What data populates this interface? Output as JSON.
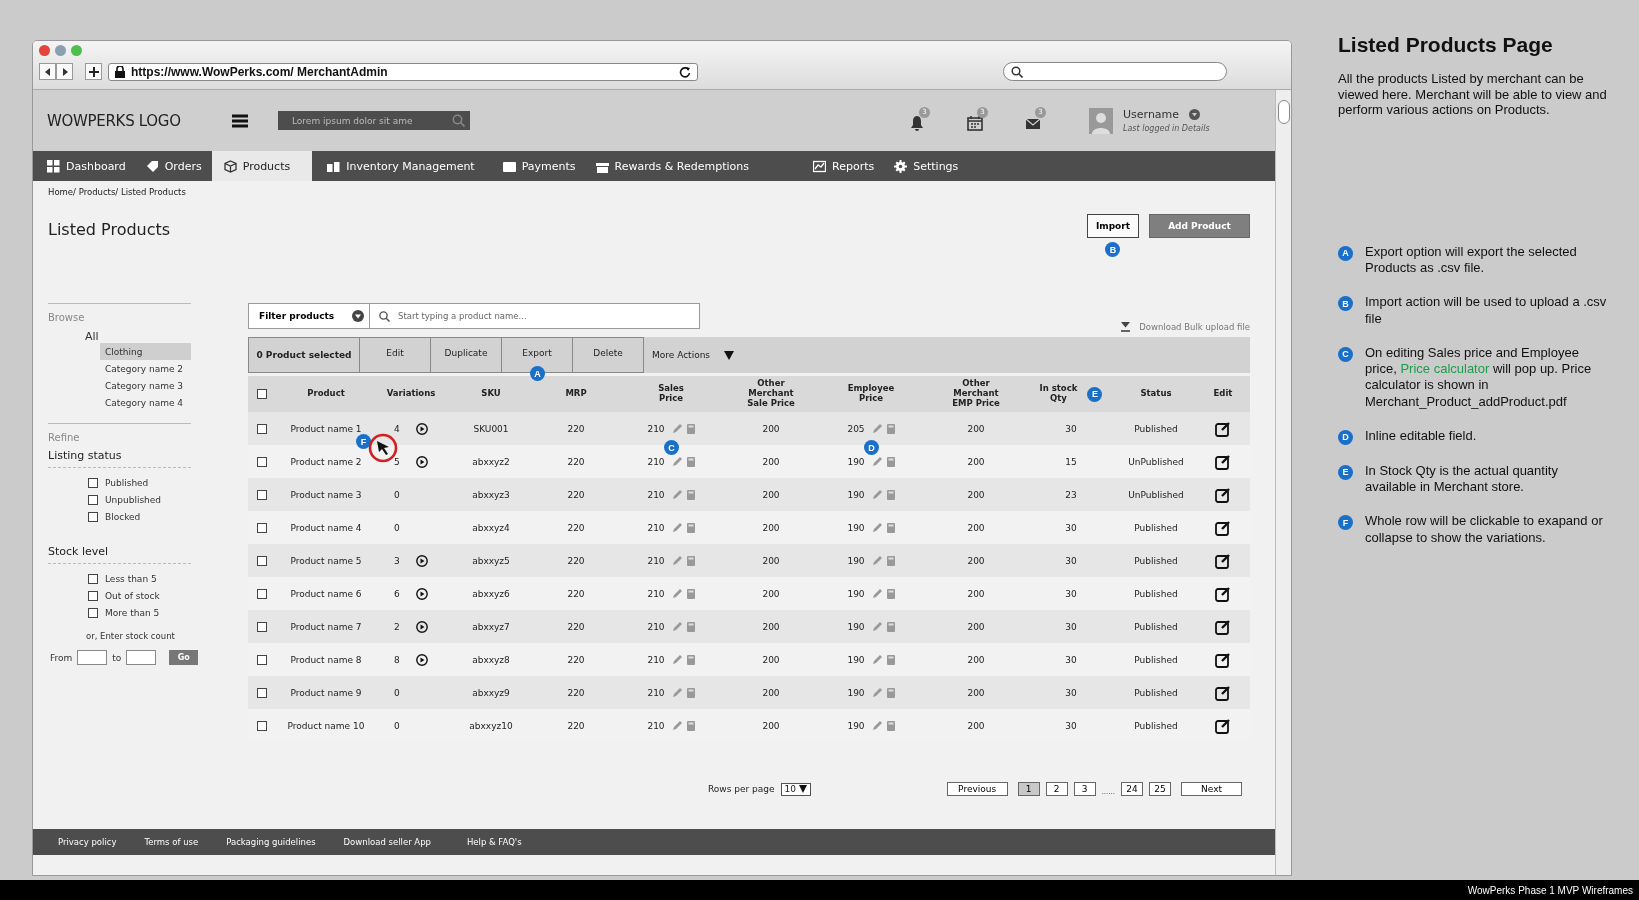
{
  "browser": {
    "url": "https://www.WowPerks.com/ MerchantAdmin"
  },
  "header": {
    "logo": "WOWPERKS LOGO",
    "search_placeholder": "Lorem ipsum dolor sit ame",
    "alerts": [
      {
        "kind": "bell",
        "count": "3"
      },
      {
        "kind": "calendar",
        "count": "3"
      },
      {
        "kind": "mail",
        "count": "3"
      }
    ],
    "user": {
      "name": "Username",
      "subtitle": "Last logged in Details"
    }
  },
  "nav": [
    {
      "label": "Dashboard",
      "selected": false
    },
    {
      "label": "Orders",
      "selected": false
    },
    {
      "label": "Products",
      "selected": true
    },
    {
      "label": "Inventory Management",
      "selected": false
    },
    {
      "label": "Payments",
      "selected": false
    },
    {
      "label": "Rewards & Redemptions",
      "selected": false
    },
    {
      "label": "Reports",
      "selected": false
    },
    {
      "label": "Settings",
      "selected": false
    }
  ],
  "breadcrumb": "Home/ Products/ Listed Products",
  "page_title": "Listed Products",
  "top_buttons": {
    "import": "Import",
    "import_marker": "B",
    "add": "Add Product"
  },
  "sidebar": {
    "browse_title": "Browse",
    "all": "All",
    "categories": [
      {
        "label": "Clothing",
        "selected": true
      },
      {
        "label": "Category name 2",
        "selected": false
      },
      {
        "label": "Category name 3",
        "selected": false
      },
      {
        "label": "Category name 4",
        "selected": false
      }
    ],
    "refine_title": "Refine",
    "groups": [
      {
        "title": "Listing status",
        "options": [
          {
            "label": "Published",
            "checked": false
          },
          {
            "label": "Unpublished",
            "checked": false
          },
          {
            "label": "Blocked",
            "checked": false
          }
        ]
      },
      {
        "title": "Stock level",
        "options": [
          {
            "label": "Less than 5",
            "checked": false
          },
          {
            "label": "Out of stock",
            "checked": false
          },
          {
            "label": "More than 5",
            "checked": false
          }
        ]
      }
    ],
    "stock_hint": "or, Enter stock count",
    "from_label": "From",
    "to_label": "to",
    "go": "Go"
  },
  "toolbar": {
    "filter": "Filter products",
    "search_placeholder": "Start typing a product name...",
    "download": "Download Bulk upload file",
    "selected_count": "0 Product selected",
    "actions": [
      {
        "label": "Edit"
      },
      {
        "label": "Duplicate"
      },
      {
        "label": "Export",
        "marker": "A"
      },
      {
        "label": "Delete"
      }
    ],
    "more": "More Actions"
  },
  "table": {
    "all_checked": false,
    "columns": [
      {
        "label": "Product"
      },
      {
        "label": "Variations",
        "row_marker": "F"
      },
      {
        "label": "SKU"
      },
      {
        "label": "MRP"
      },
      {
        "label": "Sales\nPrice",
        "row_marker": "C"
      },
      {
        "label": "Other\nMerchant\nSale Price"
      },
      {
        "label": "Employee\nPrice",
        "row_marker": "D"
      },
      {
        "label": "Other\nMerchant\nEMP Price"
      },
      {
        "label": "In stock\nQty",
        "marker": "E"
      },
      {
        "label": "Status"
      },
      {
        "label": "Edit"
      }
    ],
    "rows": [
      {
        "checked": false,
        "product": "Product name 1",
        "variations": "4",
        "has_variants": true,
        "sku": "SKU001",
        "mrp": "220",
        "sales_price": "210",
        "other_sale": "200",
        "employee_price": "205",
        "other_emp": "200",
        "stock": "30",
        "status": "Published"
      },
      {
        "checked": false,
        "product": "Product name 2",
        "variations": "5",
        "has_variants": true,
        "sku": "abxxyz2",
        "mrp": "220",
        "sales_price": "210",
        "other_sale": "200",
        "employee_price": "190",
        "other_emp": "200",
        "stock": "15",
        "status": "UnPublished"
      },
      {
        "checked": false,
        "product": "Product name 3",
        "variations": "0",
        "has_variants": false,
        "sku": "abxxyz3",
        "mrp": "220",
        "sales_price": "210",
        "other_sale": "200",
        "employee_price": "190",
        "other_emp": "200",
        "stock": "23",
        "status": "UnPublished"
      },
      {
        "checked": false,
        "product": "Product name 4",
        "variations": "0",
        "has_variants": false,
        "sku": "abxxyz4",
        "mrp": "220",
        "sales_price": "210",
        "other_sale": "200",
        "employee_price": "190",
        "other_emp": "200",
        "stock": "30",
        "status": "Published"
      },
      {
        "checked": false,
        "product": "Product name 5",
        "variations": "3",
        "has_variants": true,
        "sku": "abxxyz5",
        "mrp": "220",
        "sales_price": "210",
        "other_sale": "200",
        "employee_price": "190",
        "other_emp": "200",
        "stock": "30",
        "status": "Published"
      },
      {
        "checked": false,
        "product": "Product name 6",
        "variations": "6",
        "has_variants": true,
        "sku": "abxxyz6",
        "mrp": "220",
        "sales_price": "210",
        "other_sale": "200",
        "employee_price": "190",
        "other_emp": "200",
        "stock": "30",
        "status": "Published"
      },
      {
        "checked": false,
        "product": "Product name 7",
        "variations": "2",
        "has_variants": true,
        "sku": "abxxyz7",
        "mrp": "220",
        "sales_price": "210",
        "other_sale": "200",
        "employee_price": "190",
        "other_emp": "200",
        "stock": "30",
        "status": "Published"
      },
      {
        "checked": false,
        "product": "Product name 8",
        "variations": "8",
        "has_variants": true,
        "sku": "abxxyz8",
        "mrp": "220",
        "sales_price": "210",
        "other_sale": "200",
        "employee_price": "190",
        "other_emp": "200",
        "stock": "30",
        "status": "Published"
      },
      {
        "checked": false,
        "product": "Product name 9",
        "variations": "0",
        "has_variants": false,
        "sku": "abxxyz9",
        "mrp": "220",
        "sales_price": "210",
        "other_sale": "200",
        "employee_price": "190",
        "other_emp": "200",
        "stock": "30",
        "status": "Published"
      },
      {
        "checked": false,
        "product": "Product name 10",
        "variations": "0",
        "has_variants": false,
        "sku": "abxxyz10",
        "mrp": "220",
        "sales_price": "210",
        "other_sale": "200",
        "employee_price": "190",
        "other_emp": "200",
        "stock": "30",
        "status": "Published"
      }
    ]
  },
  "pagination": {
    "rows_label": "Rows per page",
    "rows_value": "10",
    "previous": "Previous",
    "next": "Next",
    "pages": [
      {
        "kind": "page",
        "label": "1",
        "selected": true
      },
      {
        "kind": "page",
        "label": "2",
        "selected": false
      },
      {
        "kind": "page",
        "label": "3",
        "selected": false
      },
      {
        "kind": "gap",
        "label": "......"
      },
      {
        "kind": "page",
        "label": "24",
        "selected": false
      },
      {
        "kind": "page",
        "label": "25",
        "selected": false
      }
    ]
  },
  "footer": [
    "Privacy policy",
    "Terms of use",
    "Packaging guidelines",
    "Download seller App",
    "Help & FAQ's"
  ],
  "notes_panel": {
    "title": "Listed Products Page",
    "intro": "All the products Listed by merchant can be viewed here. Merchant will be able to view and perform various actions on Products.",
    "notes": [
      {
        "marker": "A",
        "text": "Export option will export the selected Products as .csv file."
      },
      {
        "marker": "B",
        "text": "Import action will be used to upload a .csv file"
      },
      {
        "marker": "C",
        "text": "On editing Sales price and Employee price,",
        "link": "Price calculator",
        "after": "will pop up. Price calculator is shown in Merchant_Product_addProduct.pdf"
      },
      {
        "marker": "D",
        "text": "Inline editable field."
      },
      {
        "marker": "E",
        "text": "In Stock Qty is the actual quantity available in Merchant store."
      },
      {
        "marker": "F",
        "text": "Whole row will be clickable to exapand or collapse to show the variations."
      }
    ]
  },
  "caption": "WowPerks Phase 1 MVP Wireframes"
}
